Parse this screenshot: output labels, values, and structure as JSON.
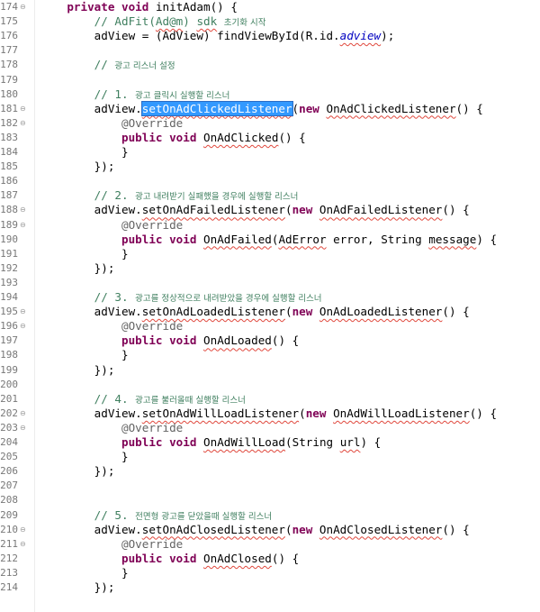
{
  "editor": {
    "language": "java",
    "selection": "setOnAdClickedListener",
    "colors": {
      "keyword": "#7f0055",
      "comment": "#3f7f5f",
      "annotation": "#646464",
      "field": "#0000c0",
      "selection": "#3399ff",
      "error_underline": "#e0483d"
    },
    "lines": [
      {
        "num": "174",
        "fold": "⊖",
        "code": "    private void initAdam() {"
      },
      {
        "num": "175",
        "fold": "",
        "code": "        // AdFit(Ad@m) sdk 초기화 시작"
      },
      {
        "num": "176",
        "fold": "",
        "code": "        adView = (AdView) findViewById(R.id.adview);"
      },
      {
        "num": "177",
        "fold": "",
        "code": ""
      },
      {
        "num": "178",
        "fold": "",
        "code": "        // 광고 리스너 설정"
      },
      {
        "num": "179",
        "fold": "",
        "code": ""
      },
      {
        "num": "180",
        "fold": "",
        "code": "        // 1. 광고 클릭시 실행할 리스너"
      },
      {
        "num": "181",
        "fold": "⊖",
        "code": "        adView.setOnAdClickedListener(new OnAdClickedListener() {"
      },
      {
        "num": "182",
        "fold": "⊖",
        "code": "            @Override"
      },
      {
        "num": "183",
        "fold": "",
        "code": "            public void OnAdClicked() {"
      },
      {
        "num": "184",
        "fold": "",
        "code": "            }"
      },
      {
        "num": "185",
        "fold": "",
        "code": "        });"
      },
      {
        "num": "186",
        "fold": "",
        "code": ""
      },
      {
        "num": "187",
        "fold": "",
        "code": "        // 2. 광고 내려받기 실패했을 경우에 실행할 리스너"
      },
      {
        "num": "188",
        "fold": "⊖",
        "code": "        adView.setOnAdFailedListener(new OnAdFailedListener() {"
      },
      {
        "num": "189",
        "fold": "⊖",
        "code": "            @Override"
      },
      {
        "num": "190",
        "fold": "",
        "code": "            public void OnAdFailed(AdError error, String message) {"
      },
      {
        "num": "191",
        "fold": "",
        "code": "            }"
      },
      {
        "num": "192",
        "fold": "",
        "code": "        });"
      },
      {
        "num": "193",
        "fold": "",
        "code": ""
      },
      {
        "num": "194",
        "fold": "",
        "code": "        // 3. 광고를 정상적으로 내려받았을 경우에 실행할 리스너"
      },
      {
        "num": "195",
        "fold": "⊖",
        "code": "        adView.setOnAdLoadedListener(new OnAdLoadedListener() {"
      },
      {
        "num": "196",
        "fold": "⊖",
        "code": "            @Override"
      },
      {
        "num": "197",
        "fold": "",
        "code": "            public void OnAdLoaded() {"
      },
      {
        "num": "198",
        "fold": "",
        "code": "            }"
      },
      {
        "num": "199",
        "fold": "",
        "code": "        });"
      },
      {
        "num": "200",
        "fold": "",
        "code": ""
      },
      {
        "num": "201",
        "fold": "",
        "code": "        // 4. 광고를 불러올때 실행할 리스너"
      },
      {
        "num": "202",
        "fold": "⊖",
        "code": "        adView.setOnAdWillLoadListener(new OnAdWillLoadListener() {"
      },
      {
        "num": "203",
        "fold": "⊖",
        "code": "            @Override"
      },
      {
        "num": "204",
        "fold": "",
        "code": "            public void OnAdWillLoad(String url) {"
      },
      {
        "num": "205",
        "fold": "",
        "code": "            }"
      },
      {
        "num": "206",
        "fold": "",
        "code": "        });"
      },
      {
        "num": "207",
        "fold": "",
        "code": ""
      },
      {
        "num": "208",
        "fold": "",
        "code": ""
      },
      {
        "num": "209",
        "fold": "",
        "code": "        // 5. 전면형 광고를 닫았을때 실행할 리스너"
      },
      {
        "num": "210",
        "fold": "⊖",
        "code": "        adView.setOnAdClosedListener(new OnAdClosedListener() {"
      },
      {
        "num": "211",
        "fold": "⊖",
        "code": "            @Override"
      },
      {
        "num": "212",
        "fold": "",
        "code": "            public void OnAdClosed() {"
      },
      {
        "num": "213",
        "fold": "",
        "code": "            }"
      },
      {
        "num": "214",
        "fold": "",
        "code": "        });"
      }
    ]
  }
}
